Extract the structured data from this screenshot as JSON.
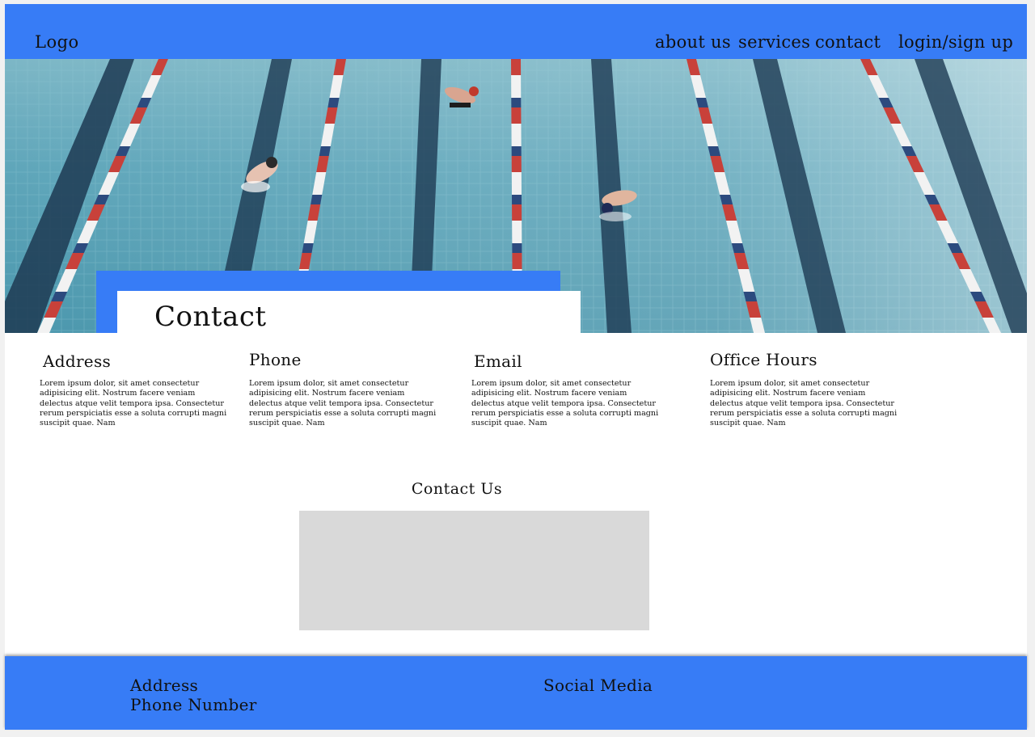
{
  "header": {
    "logo": "Logo",
    "nav": [
      {
        "label": "about us"
      },
      {
        "label": "services"
      },
      {
        "label": "contact"
      },
      {
        "label": "login/sign up"
      }
    ]
  },
  "hero": {
    "image": "swimming-pool-lanes-photo",
    "title": "Contact"
  },
  "info": [
    {
      "heading": "Address",
      "text": "Lorem ipsum dolor, sit amet consectetur adipisicing elit. Nostrum facere veniam delectus atque velit tempora ipsa. Consectetur rerum perspiciatis esse a soluta corrupti magni suscipit quae. Nam"
    },
    {
      "heading": "Phone",
      "text": "Lorem ipsum dolor, sit amet consectetur adipisicing elit. Nostrum facere veniam delectus atque velit tempora ipsa. Consectetur rerum perspiciatis esse a soluta corrupti magni suscipit quae. Nam"
    },
    {
      "heading": "Email",
      "text": "Lorem ipsum dolor, sit amet consectetur adipisicing elit. Nostrum facere veniam delectus atque velit tempora ipsa. Consectetur rerum perspiciatis esse a soluta corrupti magni suscipit quae. Nam"
    },
    {
      "heading": "Office Hours",
      "text": "Lorem ipsum dolor, sit amet consectetur adipisicing elit. Nostrum facere veniam delectus atque velit tempora ipsa. Consectetur rerum perspiciatis esse a soluta corrupti magni suscipit quae. Nam"
    }
  ],
  "contact_us": {
    "title": "Contact Us"
  },
  "footer": {
    "address": "Address",
    "phone": "Phone Number",
    "social": "Social Media"
  },
  "colors": {
    "accent": "#377cf6",
    "placeholder_box": "#d9d9d9",
    "background": "#ffffff"
  }
}
